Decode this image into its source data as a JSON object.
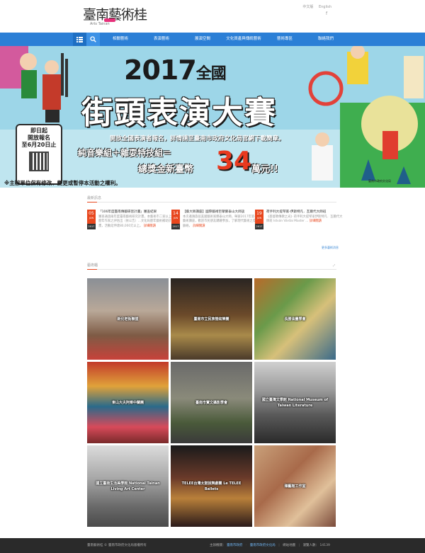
{
  "header": {
    "logo_text": "臺南藝術桂",
    "logo_sub": "Arts Tainan",
    "lang_links": [
      "中文版",
      "English"
    ],
    "fb_icon": "facebook-icon"
  },
  "nav": {
    "items": [
      "相關藝術",
      "表演藝術",
      "展演空間",
      "文化資產與傳統藝術",
      "藝術專區",
      "聯絡我們"
    ]
  },
  "banner": {
    "year": "2017",
    "national": "全國",
    "title": "街頭表演大賽",
    "desc": "開放全國表演者報名，詳情請至臺南市政府文化局官網下載簡章。",
    "groups": "純音樂組＋雜耍特技組＝",
    "prize_label": "總獎金新臺幣",
    "prize_num": "34",
    "prize_unit": "萬元!!",
    "reg_lines": [
      "即日起",
      "開放報名",
      "至6月20日止"
    ],
    "note": "※主辦單位保有修改、變更或暫停本活動之權利。",
    "organizer": "臺南市政府文化局"
  },
  "news_section": {
    "title": "最新訊息",
    "more_all": "更多藝術消息",
    "items": [
      {
        "day": "05",
        "month": "JUN",
        "year": "2017",
        "title": "「106年度臺南傳藝研習計畫」審查結果",
        "body": "審查通過兩年度臺南藝術研究計畫，本藝術市二家以上或歷年作家之評估出（依公告）...文化局歷年藝術補助計畫，活動延伸達80,000元以上。",
        "more": "詳細閱讀"
      },
      {
        "day": "14",
        "month": "JUN",
        "year": "2017",
        "title": "【藝大師講座】國際藝術巨擘鄭泰山大師談",
        "body": "本次邀請旅居美國藝術家鄭泰山大師，舉辦2017年第一場藝術講座，歡迎市民朋友踴躍參加，了解現代藝術之發展脈絡。",
        "more": "詳細閱讀"
      },
      {
        "day": "19",
        "month": "JUN",
        "year": "2017",
        "title": "荷手利大提琴家-伊斯特凡．瓦爾代大師班",
        "body": "《基督教傳教之光》荷手利大提琴家伊斯特凡．瓦爾代大師班 István Várdai Master ...",
        "more": "詳細閱讀"
      }
    ]
  },
  "gallery_section": {
    "title": "藝術櫃",
    "tiles": [
      "新化老街聯盟",
      "臺南市立民族管絃樂團",
      "長勝油畫學會",
      "東山大夫阿乘中蘭團",
      "臺南市寶文攝影學會",
      "國立臺灣文學館 National Museum of Taiwan Literature",
      "國立臺南生活美學館 National Tainan Living Art Center",
      "TELEE台灣太鼓說舞劇團 Le TELEE Ballets",
      "臻藝館工作室"
    ]
  },
  "footer": {
    "copy": "臺南藝術桂 © 臺南市政府文化局版權所有",
    "right_label": "主辦機關：",
    "link1": "臺南市政府",
    "link2": "臺南市政府文化局",
    "sitemap": "網站地圖",
    "visits_label": "瀏覽人數：",
    "visits": "14139"
  }
}
